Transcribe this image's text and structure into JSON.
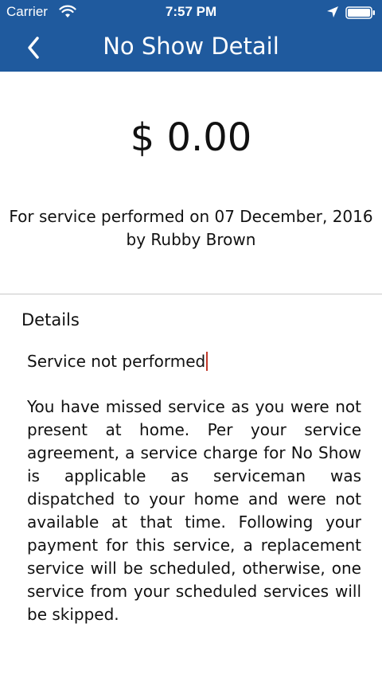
{
  "status_bar": {
    "carrier": "Carrier",
    "time": "7:57 PM",
    "icons": [
      "wifi-icon",
      "location-arrow-icon",
      "battery-icon"
    ]
  },
  "nav": {
    "title": "No Show Detail",
    "back_icon": "chevron-left-icon"
  },
  "summary": {
    "amount": "$ 0.00",
    "service_line": "For service performed on 07 December, 2016",
    "by_line": "by Rubby Brown"
  },
  "details": {
    "heading": "Details",
    "reason": "Service not performed",
    "description": "You have missed service as you were not present at home. Per your service agreement, a service charge for No Show is applicable as serviceman was dispatched to your home and were not available at that time. Following your payment for this service, a replacement service will be scheduled, otherwise, one service from your scheduled services will be skipped."
  },
  "colors": {
    "header_bg": "#1f5a9e",
    "header_text": "#ffffff",
    "caret": "#c0392b",
    "divider": "#c8c8c8"
  }
}
